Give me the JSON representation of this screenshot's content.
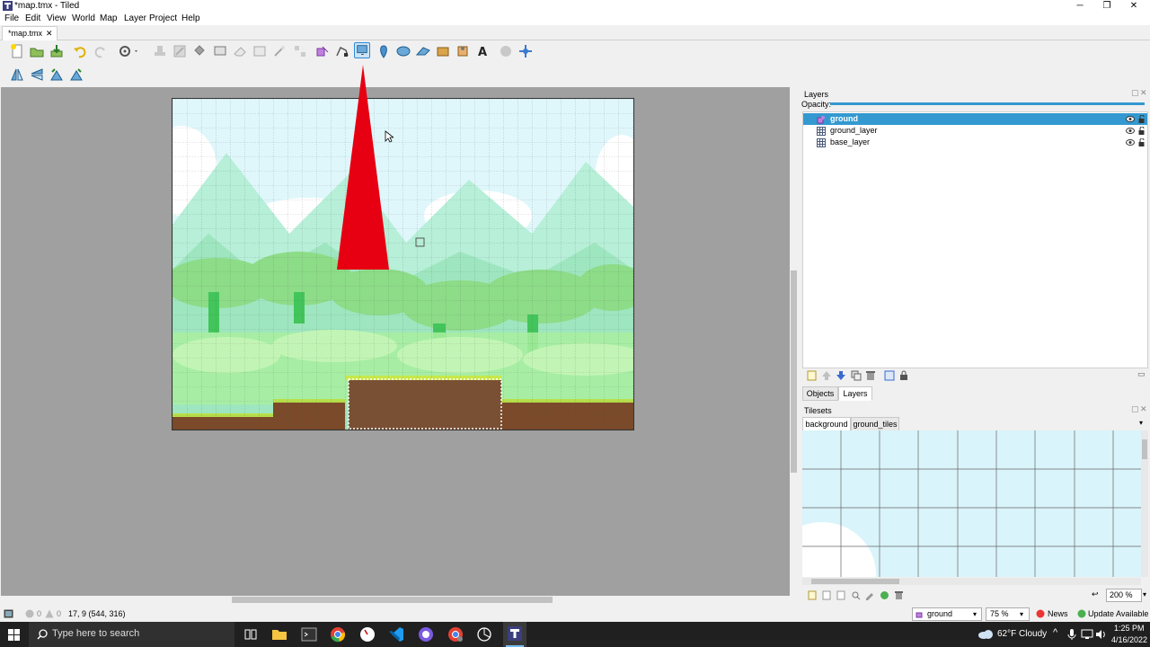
{
  "window": {
    "title": "*map.tmx - Tiled",
    "min": "─",
    "max": "❐",
    "close": "✕"
  },
  "menu": [
    "File",
    "Edit",
    "View",
    "World",
    "Map",
    "Layer",
    "Project",
    "Help"
  ],
  "doc_tab": {
    "label": "*map.tmx",
    "close": "✕"
  },
  "toolbar": {
    "icons": [
      "new-map-icon",
      "open-icon",
      "save-icon",
      "undo-icon",
      "redo-icon",
      "commands-icon",
      "stamp-brush-icon",
      "terrain-brush-icon",
      "bucket-fill-icon",
      "shape-fill-icon",
      "eraser-icon",
      "rectangular-select-icon",
      "magic-wand-icon",
      "select-same-tile-icon",
      "select-objects-icon",
      "edit-polygons-icon",
      "insert-rectangle-icon",
      "insert-point-icon",
      "insert-ellipse-icon",
      "insert-polygon-icon",
      "insert-tile-icon",
      "insert-template-icon",
      "insert-text-icon",
      "world-tool-icon",
      "move-world-icon"
    ],
    "selected": "insert-rectangle-icon",
    "row2": [
      "flip-horizontal-icon",
      "flip-vertical-icon",
      "rotate-left-icon",
      "rotate-right-icon"
    ]
  },
  "layers_panel": {
    "title": "Layers",
    "opacity_label": "Opacity:",
    "opacity": 1.0,
    "layers": [
      {
        "name": "ground",
        "type": "object",
        "selected": true
      },
      {
        "name": "ground_layer",
        "type": "tile",
        "selected": false
      },
      {
        "name": "base_layer",
        "type": "tile",
        "selected": false
      }
    ],
    "tabs": [
      "Objects",
      "Layers"
    ],
    "active_tab": "Layers"
  },
  "tilesets_panel": {
    "title": "Tilesets",
    "tabs": [
      "background",
      "ground_tiles"
    ],
    "active_tab": "background",
    "zoom": "200 %"
  },
  "status": {
    "errors": "0",
    "warnings": "0",
    "coords": "17, 9 (544, 316)",
    "layer": "ground",
    "zoom": "75 %",
    "news": "News",
    "update": "Update Available"
  },
  "taskbar": {
    "search_placeholder": "Type here to search",
    "weather": "62°F  Cloudy",
    "time": "1:25 PM",
    "date": "4/16/2022"
  },
  "colors": {
    "accent": "#3399d0",
    "sky": "#d9f4fa",
    "ground": "#7a4a2a",
    "grass": "#9be07a",
    "red_mark": "#e60012"
  }
}
